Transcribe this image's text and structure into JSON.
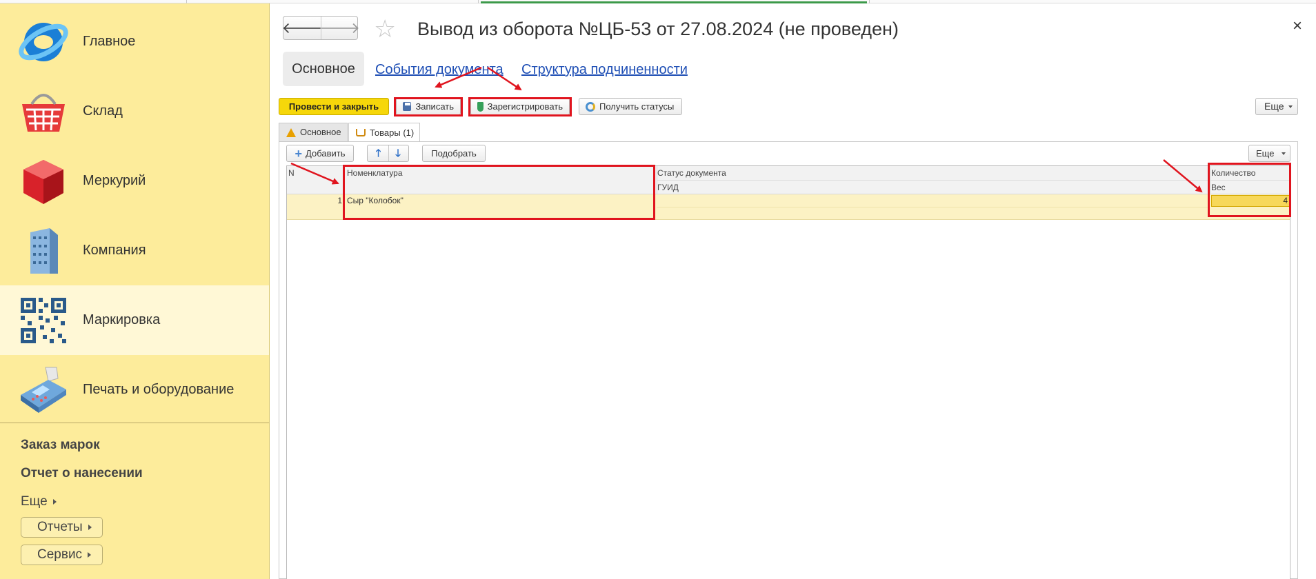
{
  "sidebar": {
    "sections": [
      {
        "label": "Главное",
        "icon": "globe-logo-icon"
      },
      {
        "label": "Склад",
        "icon": "basket-icon"
      },
      {
        "label": "Меркурий",
        "icon": "red-cube-icon"
      },
      {
        "label": "Компания",
        "icon": "building-icon"
      },
      {
        "label": "Маркировка",
        "icon": "qr-code-icon"
      },
      {
        "label": "Печать и оборудование",
        "icon": "printer-terminal-icon"
      }
    ],
    "active_section": "Маркировка",
    "links": [
      "Заказ марок",
      "Отчет о нанесении"
    ],
    "more_label": "Еще",
    "buttons": [
      "Отчеты",
      "Сервис"
    ]
  },
  "header": {
    "title": "Вывод из оборота №ЦБ-53 от 27.08.2024 (не проведен)",
    "back_icon": "arrow-left-icon",
    "forward_icon": "arrow-right-icon",
    "favorite_icon": "star-icon",
    "close_icon": "close-icon",
    "close_glyph": "×"
  },
  "tabs": {
    "main": "Основное",
    "links": [
      "События документа",
      "Структура подчиненности"
    ]
  },
  "toolbar": {
    "post_and_close": "Провести и закрыть",
    "save": "Записать",
    "register": "Зарегистрировать",
    "get_statuses": "Получить статусы",
    "more": "Еще"
  },
  "page_tabs": {
    "main": "Основное",
    "goods": "Товары (1)"
  },
  "goods_toolbar": {
    "add": "Добавить",
    "pick": "Подобрать",
    "more": "Еще"
  },
  "table": {
    "columns": {
      "n": "N",
      "nomenclature": "Номенклатура",
      "doc_status": "Статус документа",
      "guid": "ГУИД",
      "quantity": "Количество",
      "weight": "Вес"
    },
    "rows": [
      {
        "n": "1",
        "nomenclature": "Сыр \"Колобок\"",
        "doc_status": "",
        "guid": "",
        "quantity": "4",
        "weight": ""
      }
    ]
  },
  "colors": {
    "sidebar_bg": "#fdec9b",
    "primary_button": "#f6d70a",
    "annotation_red": "#e0141e",
    "link_blue": "#1f4fb5"
  }
}
